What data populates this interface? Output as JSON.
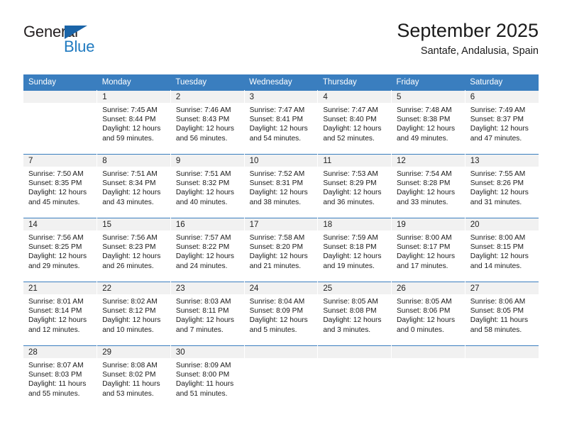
{
  "brand": {
    "name_top": "General",
    "name_bottom": "Blue",
    "accent_color": "#1f7ac0",
    "triangle_color": "#1a64a8",
    "triangle_icon": "triangle-icon"
  },
  "header": {
    "title": "September 2025",
    "subtitle": "Santafe, Andalusia, Spain"
  },
  "theme": {
    "header_row_bg": "#3a7ebf",
    "header_row_text": "#ffffff",
    "daynum_band_bg": "#f1f1f1",
    "cell_text": "#1a1a1a"
  },
  "weekday_headers": [
    "Sunday",
    "Monday",
    "Tuesday",
    "Wednesday",
    "Thursday",
    "Friday",
    "Saturday"
  ],
  "weeks": [
    [
      {
        "day": "",
        "sunrise": "",
        "sunset": "",
        "daylight_line1": "",
        "daylight_line2": ""
      },
      {
        "day": "1",
        "sunrise": "Sunrise: 7:45 AM",
        "sunset": "Sunset: 8:44 PM",
        "daylight_line1": "Daylight: 12 hours",
        "daylight_line2": "and 59 minutes."
      },
      {
        "day": "2",
        "sunrise": "Sunrise: 7:46 AM",
        "sunset": "Sunset: 8:43 PM",
        "daylight_line1": "Daylight: 12 hours",
        "daylight_line2": "and 56 minutes."
      },
      {
        "day": "3",
        "sunrise": "Sunrise: 7:47 AM",
        "sunset": "Sunset: 8:41 PM",
        "daylight_line1": "Daylight: 12 hours",
        "daylight_line2": "and 54 minutes."
      },
      {
        "day": "4",
        "sunrise": "Sunrise: 7:47 AM",
        "sunset": "Sunset: 8:40 PM",
        "daylight_line1": "Daylight: 12 hours",
        "daylight_line2": "and 52 minutes."
      },
      {
        "day": "5",
        "sunrise": "Sunrise: 7:48 AM",
        "sunset": "Sunset: 8:38 PM",
        "daylight_line1": "Daylight: 12 hours",
        "daylight_line2": "and 49 minutes."
      },
      {
        "day": "6",
        "sunrise": "Sunrise: 7:49 AM",
        "sunset": "Sunset: 8:37 PM",
        "daylight_line1": "Daylight: 12 hours",
        "daylight_line2": "and 47 minutes."
      }
    ],
    [
      {
        "day": "7",
        "sunrise": "Sunrise: 7:50 AM",
        "sunset": "Sunset: 8:35 PM",
        "daylight_line1": "Daylight: 12 hours",
        "daylight_line2": "and 45 minutes."
      },
      {
        "day": "8",
        "sunrise": "Sunrise: 7:51 AM",
        "sunset": "Sunset: 8:34 PM",
        "daylight_line1": "Daylight: 12 hours",
        "daylight_line2": "and 43 minutes."
      },
      {
        "day": "9",
        "sunrise": "Sunrise: 7:51 AM",
        "sunset": "Sunset: 8:32 PM",
        "daylight_line1": "Daylight: 12 hours",
        "daylight_line2": "and 40 minutes."
      },
      {
        "day": "10",
        "sunrise": "Sunrise: 7:52 AM",
        "sunset": "Sunset: 8:31 PM",
        "daylight_line1": "Daylight: 12 hours",
        "daylight_line2": "and 38 minutes."
      },
      {
        "day": "11",
        "sunrise": "Sunrise: 7:53 AM",
        "sunset": "Sunset: 8:29 PM",
        "daylight_line1": "Daylight: 12 hours",
        "daylight_line2": "and 36 minutes."
      },
      {
        "day": "12",
        "sunrise": "Sunrise: 7:54 AM",
        "sunset": "Sunset: 8:28 PM",
        "daylight_line1": "Daylight: 12 hours",
        "daylight_line2": "and 33 minutes."
      },
      {
        "day": "13",
        "sunrise": "Sunrise: 7:55 AM",
        "sunset": "Sunset: 8:26 PM",
        "daylight_line1": "Daylight: 12 hours",
        "daylight_line2": "and 31 minutes."
      }
    ],
    [
      {
        "day": "14",
        "sunrise": "Sunrise: 7:56 AM",
        "sunset": "Sunset: 8:25 PM",
        "daylight_line1": "Daylight: 12 hours",
        "daylight_line2": "and 29 minutes."
      },
      {
        "day": "15",
        "sunrise": "Sunrise: 7:56 AM",
        "sunset": "Sunset: 8:23 PM",
        "daylight_line1": "Daylight: 12 hours",
        "daylight_line2": "and 26 minutes."
      },
      {
        "day": "16",
        "sunrise": "Sunrise: 7:57 AM",
        "sunset": "Sunset: 8:22 PM",
        "daylight_line1": "Daylight: 12 hours",
        "daylight_line2": "and 24 minutes."
      },
      {
        "day": "17",
        "sunrise": "Sunrise: 7:58 AM",
        "sunset": "Sunset: 8:20 PM",
        "daylight_line1": "Daylight: 12 hours",
        "daylight_line2": "and 21 minutes."
      },
      {
        "day": "18",
        "sunrise": "Sunrise: 7:59 AM",
        "sunset": "Sunset: 8:18 PM",
        "daylight_line1": "Daylight: 12 hours",
        "daylight_line2": "and 19 minutes."
      },
      {
        "day": "19",
        "sunrise": "Sunrise: 8:00 AM",
        "sunset": "Sunset: 8:17 PM",
        "daylight_line1": "Daylight: 12 hours",
        "daylight_line2": "and 17 minutes."
      },
      {
        "day": "20",
        "sunrise": "Sunrise: 8:00 AM",
        "sunset": "Sunset: 8:15 PM",
        "daylight_line1": "Daylight: 12 hours",
        "daylight_line2": "and 14 minutes."
      }
    ],
    [
      {
        "day": "21",
        "sunrise": "Sunrise: 8:01 AM",
        "sunset": "Sunset: 8:14 PM",
        "daylight_line1": "Daylight: 12 hours",
        "daylight_line2": "and 12 minutes."
      },
      {
        "day": "22",
        "sunrise": "Sunrise: 8:02 AM",
        "sunset": "Sunset: 8:12 PM",
        "daylight_line1": "Daylight: 12 hours",
        "daylight_line2": "and 10 minutes."
      },
      {
        "day": "23",
        "sunrise": "Sunrise: 8:03 AM",
        "sunset": "Sunset: 8:11 PM",
        "daylight_line1": "Daylight: 12 hours",
        "daylight_line2": "and 7 minutes."
      },
      {
        "day": "24",
        "sunrise": "Sunrise: 8:04 AM",
        "sunset": "Sunset: 8:09 PM",
        "daylight_line1": "Daylight: 12 hours",
        "daylight_line2": "and 5 minutes."
      },
      {
        "day": "25",
        "sunrise": "Sunrise: 8:05 AM",
        "sunset": "Sunset: 8:08 PM",
        "daylight_line1": "Daylight: 12 hours",
        "daylight_line2": "and 3 minutes."
      },
      {
        "day": "26",
        "sunrise": "Sunrise: 8:05 AM",
        "sunset": "Sunset: 8:06 PM",
        "daylight_line1": "Daylight: 12 hours",
        "daylight_line2": "and 0 minutes."
      },
      {
        "day": "27",
        "sunrise": "Sunrise: 8:06 AM",
        "sunset": "Sunset: 8:05 PM",
        "daylight_line1": "Daylight: 11 hours",
        "daylight_line2": "and 58 minutes."
      }
    ],
    [
      {
        "day": "28",
        "sunrise": "Sunrise: 8:07 AM",
        "sunset": "Sunset: 8:03 PM",
        "daylight_line1": "Daylight: 11 hours",
        "daylight_line2": "and 55 minutes."
      },
      {
        "day": "29",
        "sunrise": "Sunrise: 8:08 AM",
        "sunset": "Sunset: 8:02 PM",
        "daylight_line1": "Daylight: 11 hours",
        "daylight_line2": "and 53 minutes."
      },
      {
        "day": "30",
        "sunrise": "Sunrise: 8:09 AM",
        "sunset": "Sunset: 8:00 PM",
        "daylight_line1": "Daylight: 11 hours",
        "daylight_line2": "and 51 minutes."
      },
      {
        "day": "",
        "sunrise": "",
        "sunset": "",
        "daylight_line1": "",
        "daylight_line2": ""
      },
      {
        "day": "",
        "sunrise": "",
        "sunset": "",
        "daylight_line1": "",
        "daylight_line2": ""
      },
      {
        "day": "",
        "sunrise": "",
        "sunset": "",
        "daylight_line1": "",
        "daylight_line2": ""
      },
      {
        "day": "",
        "sunrise": "",
        "sunset": "",
        "daylight_line1": "",
        "daylight_line2": ""
      }
    ]
  ]
}
